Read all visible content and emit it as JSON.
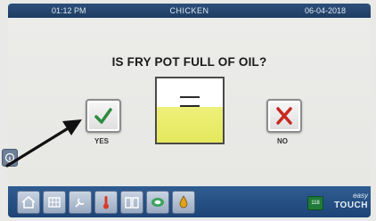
{
  "header": {
    "time": "01:12 PM",
    "product": "CHICKEN",
    "date": "06-04-2018"
  },
  "prompt": {
    "question": "IS FRY POT FULL OF OIL?"
  },
  "yes_button": {
    "label": "YES",
    "icon": "checkmark-icon",
    "color": "#2e8b3d"
  },
  "no_button": {
    "label": "NO",
    "icon": "x-icon",
    "color": "#c8281e"
  },
  "fry_pot_illustration": {
    "oil_level_fraction": 0.55,
    "oil_color": "#e4e85c"
  },
  "side_button": {
    "icon": "info-icon"
  },
  "nav_bar": {
    "items": [
      {
        "name": "home",
        "icon": "home-icon"
      },
      {
        "name": "menu",
        "icon": "grid-icon"
      },
      {
        "name": "service",
        "icon": "wrench-hand-icon"
      },
      {
        "name": "temperature",
        "icon": "thermometer-icon"
      },
      {
        "name": "recipes",
        "icon": "book-icon"
      },
      {
        "name": "filtration",
        "icon": "filter-icon"
      },
      {
        "name": "oil",
        "icon": "oil-drop-icon"
      }
    ],
    "counter": "118",
    "brand_line1": "easy",
    "brand_line2": "TOUCH"
  },
  "annotation": {
    "icon": "arrow-pointer-icon"
  }
}
